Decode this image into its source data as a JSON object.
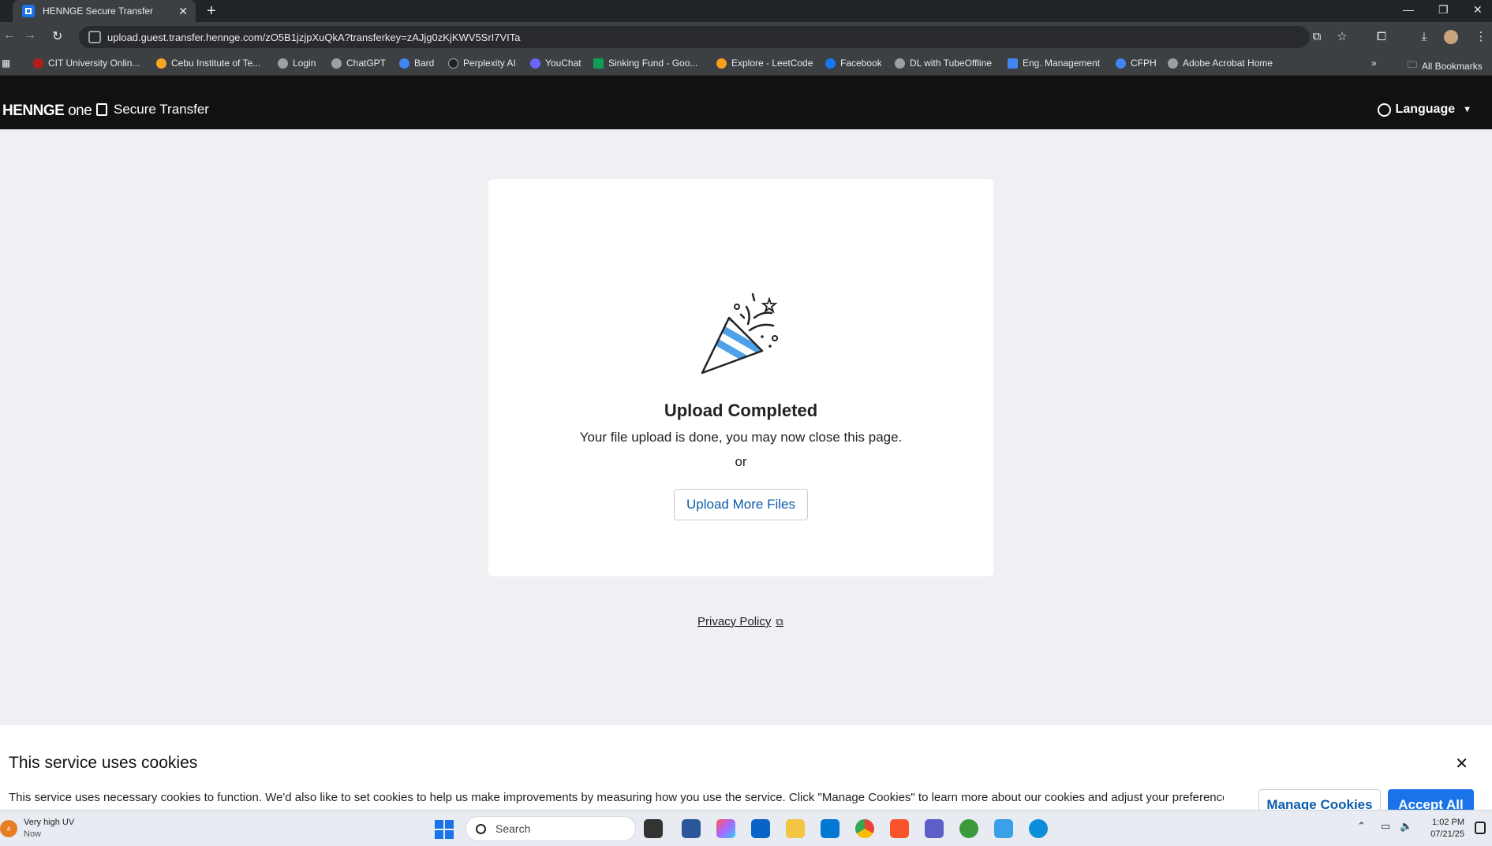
{
  "browser": {
    "tab_title": "HENNGE Secure Transfer",
    "url": "upload.guest.transfer.hennge.com/zO5B1jzjpXuQkA?transferkey=zAJjg0zKjKWV5SrI7VITa",
    "bookmarks": [
      {
        "label": "CIT University Onlin...",
        "color": "#b71c1c"
      },
      {
        "label": "Cebu Institute of Te...",
        "color": "#f5a623"
      },
      {
        "label": "Login",
        "color": "#9aa0a6"
      },
      {
        "label": "ChatGPT",
        "color": "#9aa0a6"
      },
      {
        "label": "Bard",
        "color": "#4285f4"
      },
      {
        "label": "Perplexity AI",
        "color": "#202124"
      },
      {
        "label": "YouChat",
        "color": "#6c63ff"
      },
      {
        "label": "Sinking Fund - Goo...",
        "color": "#0f9d58"
      },
      {
        "label": "Explore - LeetCode",
        "color": "#f89f1b"
      },
      {
        "label": "Facebook",
        "color": "#1877f2"
      },
      {
        "label": "DL with TubeOffline",
        "color": "#9aa0a6"
      },
      {
        "label": "Eng. Management",
        "color": "#4285f4"
      },
      {
        "label": "CFPH",
        "color": "#4285f4"
      },
      {
        "label": "Adobe Acrobat Home",
        "color": "#9aa0a6"
      }
    ],
    "all_bookmarks": "All Bookmarks"
  },
  "header": {
    "logo_left": "HENNGE",
    "logo_right": "one",
    "product": "Secure Transfer",
    "language": "Language"
  },
  "card": {
    "title": "Upload Completed",
    "message": "Your file upload is done, you may now close this page.",
    "or": "or",
    "button": "Upload More Files"
  },
  "footer": {
    "privacy": "Privacy Policy"
  },
  "cookie": {
    "title": "This service uses cookies",
    "text": "This service uses necessary cookies to function. We'd also like to set cookies to help us make improvements by measuring how you use the service. Click \"Manage Cookies\" to learn more about our cookies and adjust your preferences. For",
    "manage": "Manage Cookies",
    "accept": "Accept All"
  },
  "taskbar": {
    "weather_badge": "4",
    "weather_title": "Very high UV",
    "weather_sub": "Now",
    "search": "Search",
    "time": "1:02 PM",
    "date": "07/21/25"
  },
  "colors": {
    "accent": "#1a73e8",
    "link": "#0b5cad",
    "header_bg": "#111111",
    "page_bg": "#eef0f4"
  }
}
